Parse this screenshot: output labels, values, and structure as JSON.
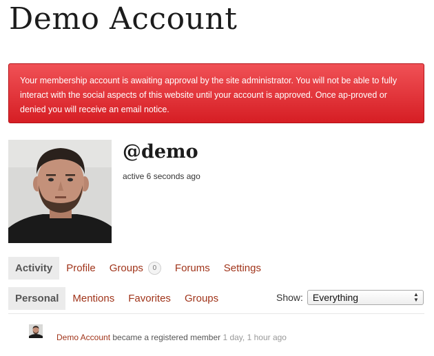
{
  "page_title": "Demo Account",
  "alert": {
    "message": "Your membership account is awaiting approval by the site administrator. You will not be able to fully interact with the social aspects of this website until your account is approved. Once ap-proved or denied you will receive an email notice.",
    "color": "#e3343a"
  },
  "profile": {
    "username": "@demo",
    "last_active": "active 6 seconds ago"
  },
  "primary_nav": [
    {
      "label": "Activity",
      "selected": true
    },
    {
      "label": "Profile"
    },
    {
      "label": "Groups",
      "count": "0"
    },
    {
      "label": "Forums"
    },
    {
      "label": "Settings"
    }
  ],
  "sub_nav": [
    {
      "label": "Personal",
      "selected": true
    },
    {
      "label": "Mentions"
    },
    {
      "label": "Favorites"
    },
    {
      "label": "Groups"
    }
  ],
  "filter": {
    "label": "Show:",
    "selected": "Everything"
  },
  "activity": {
    "user": "Demo Account",
    "action": " became a registered member ",
    "time": "1 day, 1 hour ago"
  },
  "colors": {
    "link": "#a0341a",
    "selected_tab_bg": "#ebebeb"
  }
}
